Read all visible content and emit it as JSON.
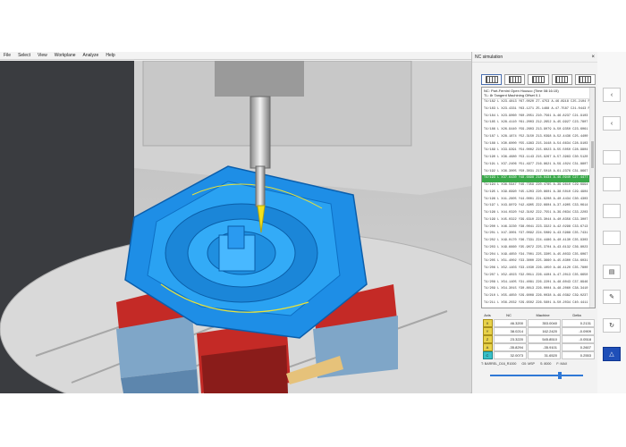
{
  "menu": [
    "File",
    "Select",
    "View",
    "Workplane",
    "Analyze",
    "Help"
  ],
  "panel": {
    "title": "NC simulation",
    "close": "×",
    "program_header": [
      "NC: Part-Fernini Open Housco (Time 08:16:15)",
      "TL: 8r Tangent Machining Offset 0.1"
    ],
    "code_lines": [
      "T4/182 L X23.4813 Y67.0020 Z7.4753 A-46.6918 C25.2104 PMAX",
      "T4/183 L X23.4331 Y63.1271 Z5.1468 A-47.7587 C21.0443 PMAX",
      "T4/184 L X23.9060 Y60.2051 Z10.7561 A-46.8237 C21.9103 PMAX",
      "T4/185 L X28.4110 Y61.2003 Z12.2652 A-45.9927 C23.7807 PMAX",
      "T4/186 L X26.9440 Y59.2603 Z13.9079 A-50.9350 C23.6061 PMAX",
      "T4/187 L X28.1874 Y52.3150 Z13.0398 A-52.4436 C25.4400 PMAX",
      "T4/188 L X30.6000 Y55.1983 Z15.3448 A-54.6634 C28.9103 PMAX",
      "T4/189 L X33.9391 Y54.0002 Z15.6023 A-55.5050 C28.9804 PMAX",
      "T4/190 L X36.4680 Y53.1143 Z15.9267 A-57.3983 C30.5120 PMAX",
      "T4/191 L X37.2406 Y51.4977 Z16.8621 A-59.1024 C31.8807 PMAX",
      "T4/192 L X36.3005 Y50.3031 Z17.5018 A-61.2376 C31.8667 PMAX",
      "T4/193 L X37.6430 Y48.6898 Z18.6434 A-46.0940 C27.4477 PMAX",
      "T4/194 L X36.5947 Y46.7359 Z20.4785 A-39.9610 C29.6994 PMAX",
      "T4/195 L X39.6990 Y45.1203 Z20.8601 A-38.5010 C29.4904 PMAX",
      "T4/196 L X41.2805 Y44.0001 Z21.6208 A-40.4434 C30.4303 PMAX",
      "T4/197 L X43.9079 Y42.4905 Z22.6604 A-37.4905 C33.0614 PMAX",
      "T4/198 L X44.0320 Y42.3102 Z22.7551 A-39.0634 C33.2203 PMAX",
      "T4/199 L X45.0322 Y39.6310 Z23.3044 A-40.8356 C33.3007 PMAX",
      "T4/200 L X46.3230 Y38.0041 Z23.3322 A-42.0298 C33.6713 PMAX",
      "T4/201 L X47.3001 Y37.0092 Z24.5089 A-43.5988 C35.7431 PMAX",
      "T4/202 L X49.0170 Y36.7331 Z24.4486 A-40.4130 C35.9303 PMAX",
      "T4/203 L X49.6660 Y35.9072 Z25.3704 A-43.6132 C36.8023 PMAX",
      "T4/204 L X49.4650 Y34.7001 Z25.3305 A-45.8033 C35.6067 PMAX",
      "T4/205 L X51.4002 Y33.3000 Z25.3660 A-45.8300 C34.6031 PMAX",
      "T4/206 L X52.1403 Y33.1030 Z26.1050 A-46.4120 C35.7800 PMAX",
      "T4/207 L X52.4023 Y32.0011 Z26.4404 A-47.2013 C35.6650 PMAX",
      "T4/208 L X54.1405 Y31.4081 Z26.2201 A-48.6043 C37.8946 PMAX",
      "T4/209 L X54.3015 Y30.8013 Z26.0004 A-48.2060 C38.3410 PMAX",
      "T4/210 L X55.4650 Y29.6008 Z26.0038 A-49.0382 C39.0237 PMAX",
      "T4/211 L X56.2032 Y29.6502 Z26.5601 A-50.2034 C40.4411 PMAX",
      "T4/212 L X57.3060 Y28.7310 Z26.3000 A-51.1060 C41.7800 PMAX",
      "T4/213 L X59.3040 Y27.4070 Z25.8060 A-52.9321 C40.2005 PMAX",
      "T4/214 L X60.4401 Y26.8301 Z25.4074 A-53.0410 C41.5600 PMAX",
      "T4/215 L X61.2304 Y26.0110 Z25.6201 A-52.1021 C40.9402 PMAX",
      "T4/216 L X62.6030 Y25.4010 Z24.4402 A-54.3060 C41.8800 PMAX",
      "T4/217 L X63.3040 Y24.2040 Z24.1605 A-55.0403 C42.3001 PMAX",
      "T4/218 L X64.6001 Y23.5220 Z23.7407 A-55.7940 C41.9300 PMAX",
      "T4/219 L X65.2025 Y22.8002 Z23.0030 A-56.3010 C42.5400 PMAX",
      "T4/220 L X66.3030 Y22.0101 Z22.8430 A-57.0403 C43.0920 PMAX"
    ],
    "highlight_index": 11,
    "axes": {
      "headers": [
        "Axis",
        "NC",
        "Machine",
        "Delta"
      ],
      "rows": [
        {
          "axis": "X",
          "nc": "46.3200",
          "machine": "353.0040",
          "delta": "0.2131"
        },
        {
          "axis": "Y",
          "nc": "38.0214",
          "machine": "162.2420",
          "delta": "-0.0909"
        },
        {
          "axis": "Z",
          "nc": "23.3220",
          "machine": "545.8510",
          "delta": "-0.0518"
        },
        {
          "axis": "A",
          "nc": "-35.8294",
          "machine": "-35.9101",
          "delta": "0.2607"
        },
        {
          "axis": "C",
          "nc": "32.0073",
          "machine": "31.6520",
          "delta": "0.2553"
        }
      ]
    },
    "status": [
      "T: BARREL_D16_R1000",
      "G0: MSP",
      "S: 8000",
      "F: MAX"
    ],
    "feed_labels": [
      "100%",
      "100%"
    ]
  },
  "colors": {
    "viewport_bg": "#c7c7c7",
    "part_blue": "#1e8ee6",
    "vise_red": "#c42a26",
    "highlight_green": "#3aa84a",
    "accent_blue": "#2f78d6"
  }
}
